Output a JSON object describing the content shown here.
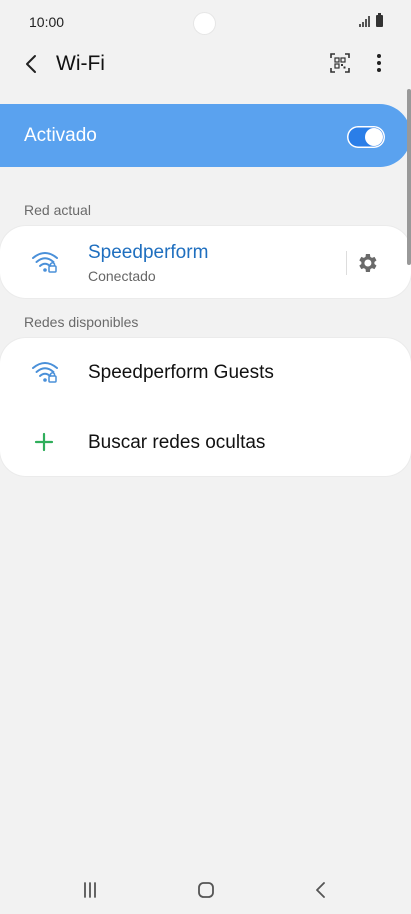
{
  "status_bar": {
    "time": "10:00"
  },
  "app_bar": {
    "title": "Wi-Fi"
  },
  "master_switch": {
    "label": "Activado",
    "enabled": true,
    "accent_color": "#5aa2ef"
  },
  "current_network": {
    "header": "Red actual",
    "name": "Speedperform",
    "status": "Conectado",
    "icon": "wifi-lock-icon"
  },
  "available_networks": {
    "header": "Redes disponibles",
    "items": [
      {
        "name": "Speedperform Guests",
        "icon": "wifi-lock-icon"
      }
    ],
    "hidden_label": "Buscar redes ocultas"
  },
  "colors": {
    "connected_text": "#1f6fbf",
    "add_icon": "#2fae5b",
    "wifi_icon": "#4a90d9"
  }
}
